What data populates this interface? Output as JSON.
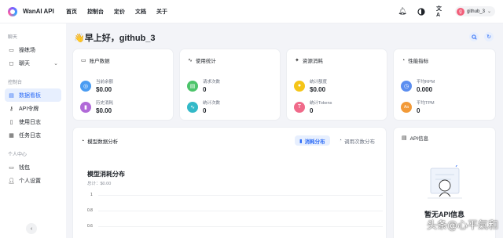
{
  "app": {
    "name": "WanAI API"
  },
  "nav": [
    "首页",
    "控制台",
    "定价",
    "文档",
    "关于"
  ],
  "user": {
    "name": "github_3",
    "avatar_letter": "g"
  },
  "sidebar": {
    "sections": [
      {
        "title": "聊天",
        "items": [
          {
            "label": "操练场"
          },
          {
            "label": "聊天"
          }
        ]
      },
      {
        "title": "控制台",
        "items": [
          {
            "label": "数据看板"
          },
          {
            "label": "API令牌"
          },
          {
            "label": "使用日志"
          },
          {
            "label": "任务日志"
          }
        ]
      },
      {
        "title": "个人中心",
        "items": [
          {
            "label": "钱包"
          },
          {
            "label": "个人设置"
          }
        ]
      }
    ],
    "active": "数据看板"
  },
  "greeting": "👋早上好，github_3",
  "cards": {
    "account": {
      "title": "账户数据",
      "stats": [
        {
          "label": "当前余额",
          "value": "$0.00"
        },
        {
          "label": "历史消耗",
          "value": "$0.00"
        }
      ]
    },
    "usage": {
      "title": "使用统计",
      "stats": [
        {
          "label": "请求次数",
          "value": "0"
        },
        {
          "label": "统计次数",
          "value": "0"
        }
      ]
    },
    "resource": {
      "title": "资源消耗",
      "stats": [
        {
          "label": "统计额度",
          "value": "$0.00"
        },
        {
          "label": "统计Tokens",
          "value": "0"
        }
      ]
    },
    "perf": {
      "title": "性能指标",
      "stats": [
        {
          "label": "平均RPM",
          "value": "0.000"
        },
        {
          "label": "平均TPM",
          "value": "0"
        }
      ]
    }
  },
  "analysis": {
    "title": "模型数据分析",
    "tabs": [
      "消耗分布",
      "调用次数分布"
    ],
    "active_tab": "消耗分布",
    "chart_title": "模型消耗分布",
    "chart_sub": "总计：$0.00"
  },
  "chart_data": {
    "type": "bar",
    "title": "模型消耗分布",
    "subtitle": "总计：$0.00",
    "categories": [],
    "values": [],
    "y_ticks": [
      "1",
      "0.8",
      "0.6"
    ]
  },
  "api_info": {
    "title": "API信息",
    "empty_text": "暂无API信息"
  },
  "watermark": "头条@心平氣和",
  "colors": {
    "accent": "#2d6cf6",
    "balance": "#4a9cf2",
    "history": "#b16ad8",
    "requests": "#4cc46a",
    "count": "#33b9c8",
    "quota": "#f5c518",
    "tokens": "#f06a8a",
    "rpm": "#5b8ef0",
    "tpm": "#f29a38"
  }
}
